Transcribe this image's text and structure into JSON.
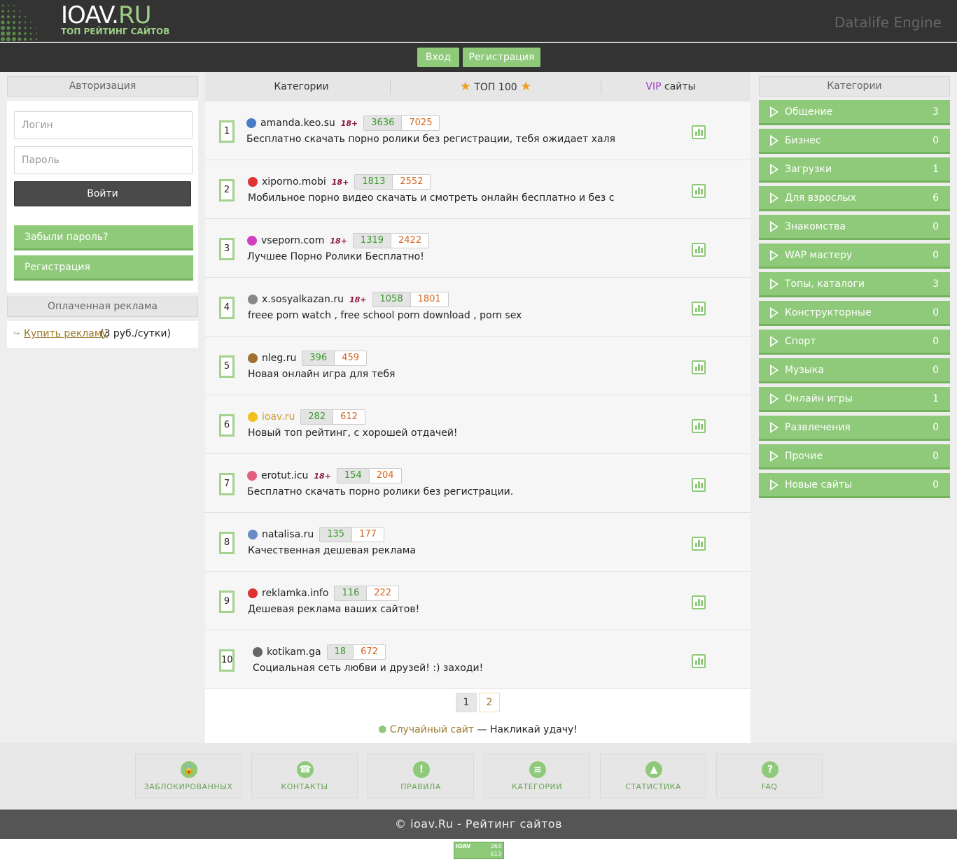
{
  "header": {
    "logo_main": "IOAV.",
    "logo_ru": "RU",
    "logo_sub": "ТОП РЕЙТИНГ САЙТОВ",
    "engine": "Datalife Engine",
    "nav": {
      "login": "Вход",
      "register": "Регистрация"
    }
  },
  "left": {
    "auth_title": "Авторизация",
    "login_placeholder": "Логин",
    "password_placeholder": "Пароль",
    "login_button": "Войти",
    "forgot": "Забыли пароль?",
    "register": "Регистрация",
    "ads_title": "Оплаченная реклама",
    "buy_ad_link": "Купить рекламу",
    "buy_ad_price": "(3 руб./сутки)"
  },
  "center": {
    "tabs": {
      "categories": "Категории",
      "top100": "ТОП 100",
      "vip": "VIP",
      "vip_rest": "сайты"
    },
    "rows": [
      {
        "rank": "1",
        "site": "amanda.keo.su",
        "adult": "18+",
        "in": "3636",
        "out": "7025",
        "desc": "Бесплатно скачать порно ролики без регистрации, тебя ожидает халя"
      },
      {
        "rank": "2",
        "site": "xiporno.mobi",
        "adult": "18+",
        "in": "1813",
        "out": "2552",
        "desc": "Мобильное порно видео скачать и смотреть онлайн бесплатно и без с"
      },
      {
        "rank": "3",
        "site": "vseporn.com",
        "adult": "18+",
        "in": "1319",
        "out": "2422",
        "desc": "Лучшее Порно Ролики Бесплатно!"
      },
      {
        "rank": "4",
        "site": "x.sosyalkazan.ru",
        "adult": "18+",
        "in": "1058",
        "out": "1801",
        "desc": "freee porn watch , free school porn download , porn sex"
      },
      {
        "rank": "5",
        "site": "nleg.ru",
        "adult": "",
        "in": "396",
        "out": "459",
        "desc": "Новая онлайн игра для тебя"
      },
      {
        "rank": "6",
        "site": "ioav.ru",
        "adult": "",
        "in": "282",
        "out": "612",
        "desc": "Новый топ рейтинг, с хорошей отдачей!"
      },
      {
        "rank": "7",
        "site": "erotut.icu",
        "adult": "18+",
        "in": "154",
        "out": "204",
        "desc": "Бесплатно скачать порно ролики без регистрации."
      },
      {
        "rank": "8",
        "site": "natalisa.ru",
        "adult": "",
        "in": "135",
        "out": "177",
        "desc": "Качественная дешевая реклама"
      },
      {
        "rank": "9",
        "site": "reklamka.info",
        "adult": "",
        "in": "116",
        "out": "222",
        "desc": "Дешевая реклама ваших сайтов!"
      },
      {
        "rank": "10",
        "site": "kotikam.ga",
        "adult": "",
        "in": "18",
        "out": "672",
        "desc": "Социальная сеть любви и друзей! :) заходи!"
      }
    ],
    "pages": [
      "1",
      "2"
    ],
    "random_link": "Случайный сайт",
    "random_rest": " — Накликай удачу!"
  },
  "right": {
    "title": "Категории",
    "categories": [
      {
        "label": "Общение",
        "count": "3"
      },
      {
        "label": "Бизнес",
        "count": "0"
      },
      {
        "label": "Загрузки",
        "count": "1"
      },
      {
        "label": "Для взрослых",
        "count": "6"
      },
      {
        "label": "Знакомства",
        "count": "0"
      },
      {
        "label": "WAP мастеру",
        "count": "0"
      },
      {
        "label": "Топы, каталоги",
        "count": "3"
      },
      {
        "label": "Конструкторные",
        "count": "0"
      },
      {
        "label": "Спорт",
        "count": "0"
      },
      {
        "label": "Музыка",
        "count": "0"
      },
      {
        "label": "Онлайн игры",
        "count": "1"
      },
      {
        "label": "Развлечения",
        "count": "0"
      },
      {
        "label": "Прочие",
        "count": "0"
      },
      {
        "label": "Новые сайты",
        "count": "0"
      }
    ]
  },
  "footer": {
    "links": [
      {
        "label": "ЗАБЛОКИРОВАННЫХ",
        "icon": "lock-icon"
      },
      {
        "label": "КОНТАКТЫ",
        "icon": "phone-icon"
      },
      {
        "label": "ПРАВИЛА",
        "icon": "warning-icon"
      },
      {
        "label": "КАТЕГОРИИ",
        "icon": "list-icon"
      },
      {
        "label": "СТАТИСТИКА",
        "icon": "stats-icon"
      },
      {
        "label": "FAQ",
        "icon": "question-icon"
      }
    ],
    "copyright": "© ioav.Ru - Рейтинг сайтов",
    "counter": {
      "label": "IOAV",
      "top": "263",
      "bottom": "613"
    }
  },
  "colors": {
    "accent": "#8fca7a",
    "dark": "#333333",
    "in": "#3a9a2c",
    "out": "#d4651f",
    "vip": "#9b3fbf"
  }
}
